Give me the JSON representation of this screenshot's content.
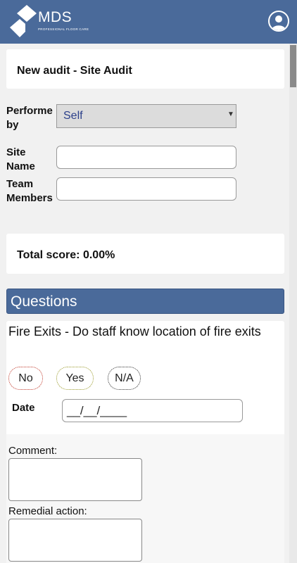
{
  "header": {
    "logo_text": "MDS",
    "logo_subtext": "PROFESSIONAL FLOOR CARE",
    "profile_icon": "user-circle-icon"
  },
  "audit": {
    "title": "New audit - Site Audit"
  },
  "form": {
    "performed_by_label": "Performe\nby",
    "performed_by_value": "Self",
    "site_name_label": "Site\nName",
    "site_name_value": "",
    "team_members_label": "Team\nMembers",
    "team_members_value": ""
  },
  "score": {
    "total_label": "Total score: 0.00%"
  },
  "questions": {
    "header": "Questions",
    "items": [
      {
        "text": "Fire Exits - Do staff know location of fire exits",
        "options": [
          "No",
          "Yes",
          "N/A"
        ],
        "date_label": "Date",
        "date_value": "__/__/____",
        "comment_label": "Comment:",
        "comment_value": "",
        "remedial_label": "Remedial action:",
        "remedial_value": ""
      }
    ]
  },
  "colors": {
    "header_bg": "#4a6a9a",
    "no_border": "#c0392b",
    "yes_border": "#9a9a2a",
    "na_border": "#333333"
  }
}
